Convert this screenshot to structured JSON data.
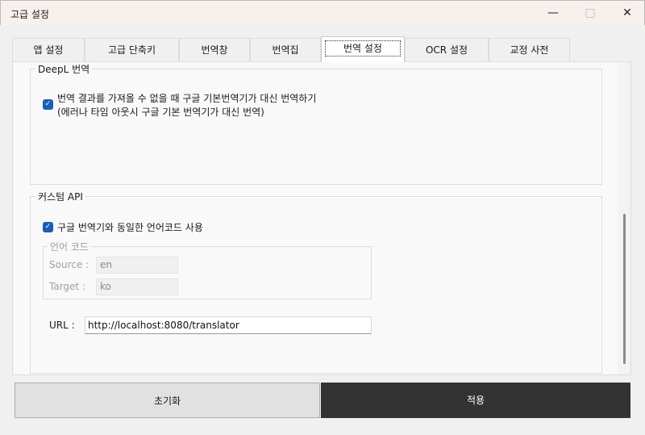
{
  "window": {
    "title": "고급 설정",
    "minimize_icon": "minimize-icon",
    "maximize_icon": "maximize-icon",
    "close_icon": "close-icon"
  },
  "tabs": [
    {
      "label": "앱 설정"
    },
    {
      "label": "고급 단축키"
    },
    {
      "label": "번역창"
    },
    {
      "label": "번역집"
    },
    {
      "label": "번역 설정"
    },
    {
      "label": "OCR 설정"
    },
    {
      "label": "교정 사전"
    }
  ],
  "selected_tab": "번역 설정",
  "deepl": {
    "title": "DeepL 번역",
    "fallback_checked": true,
    "fallback_label_line1": "번역 결과를 가져올 수 없을 때 구글 기본번역기가 대신 번역하기",
    "fallback_label_line2": "(에러나 타임 아웃시 구글 기본 번역기가 대신 번역)"
  },
  "custom_api": {
    "title": "커스텀 API",
    "same_code_checked": true,
    "same_code_label": "구글 번역기와 동일한 언어코드 사용",
    "lang_group": {
      "title": "언어 코드",
      "source_label": "Source :",
      "source_value": "en",
      "target_label": "Target :",
      "target_value": "ko"
    },
    "url_label": "URL :",
    "url_value": "http://localhost:8080/translator"
  },
  "footer": {
    "reset_label": "초기화",
    "apply_label": "적용"
  },
  "colors": {
    "accent": "#1a5fb4",
    "apply_bg": "#333333"
  }
}
